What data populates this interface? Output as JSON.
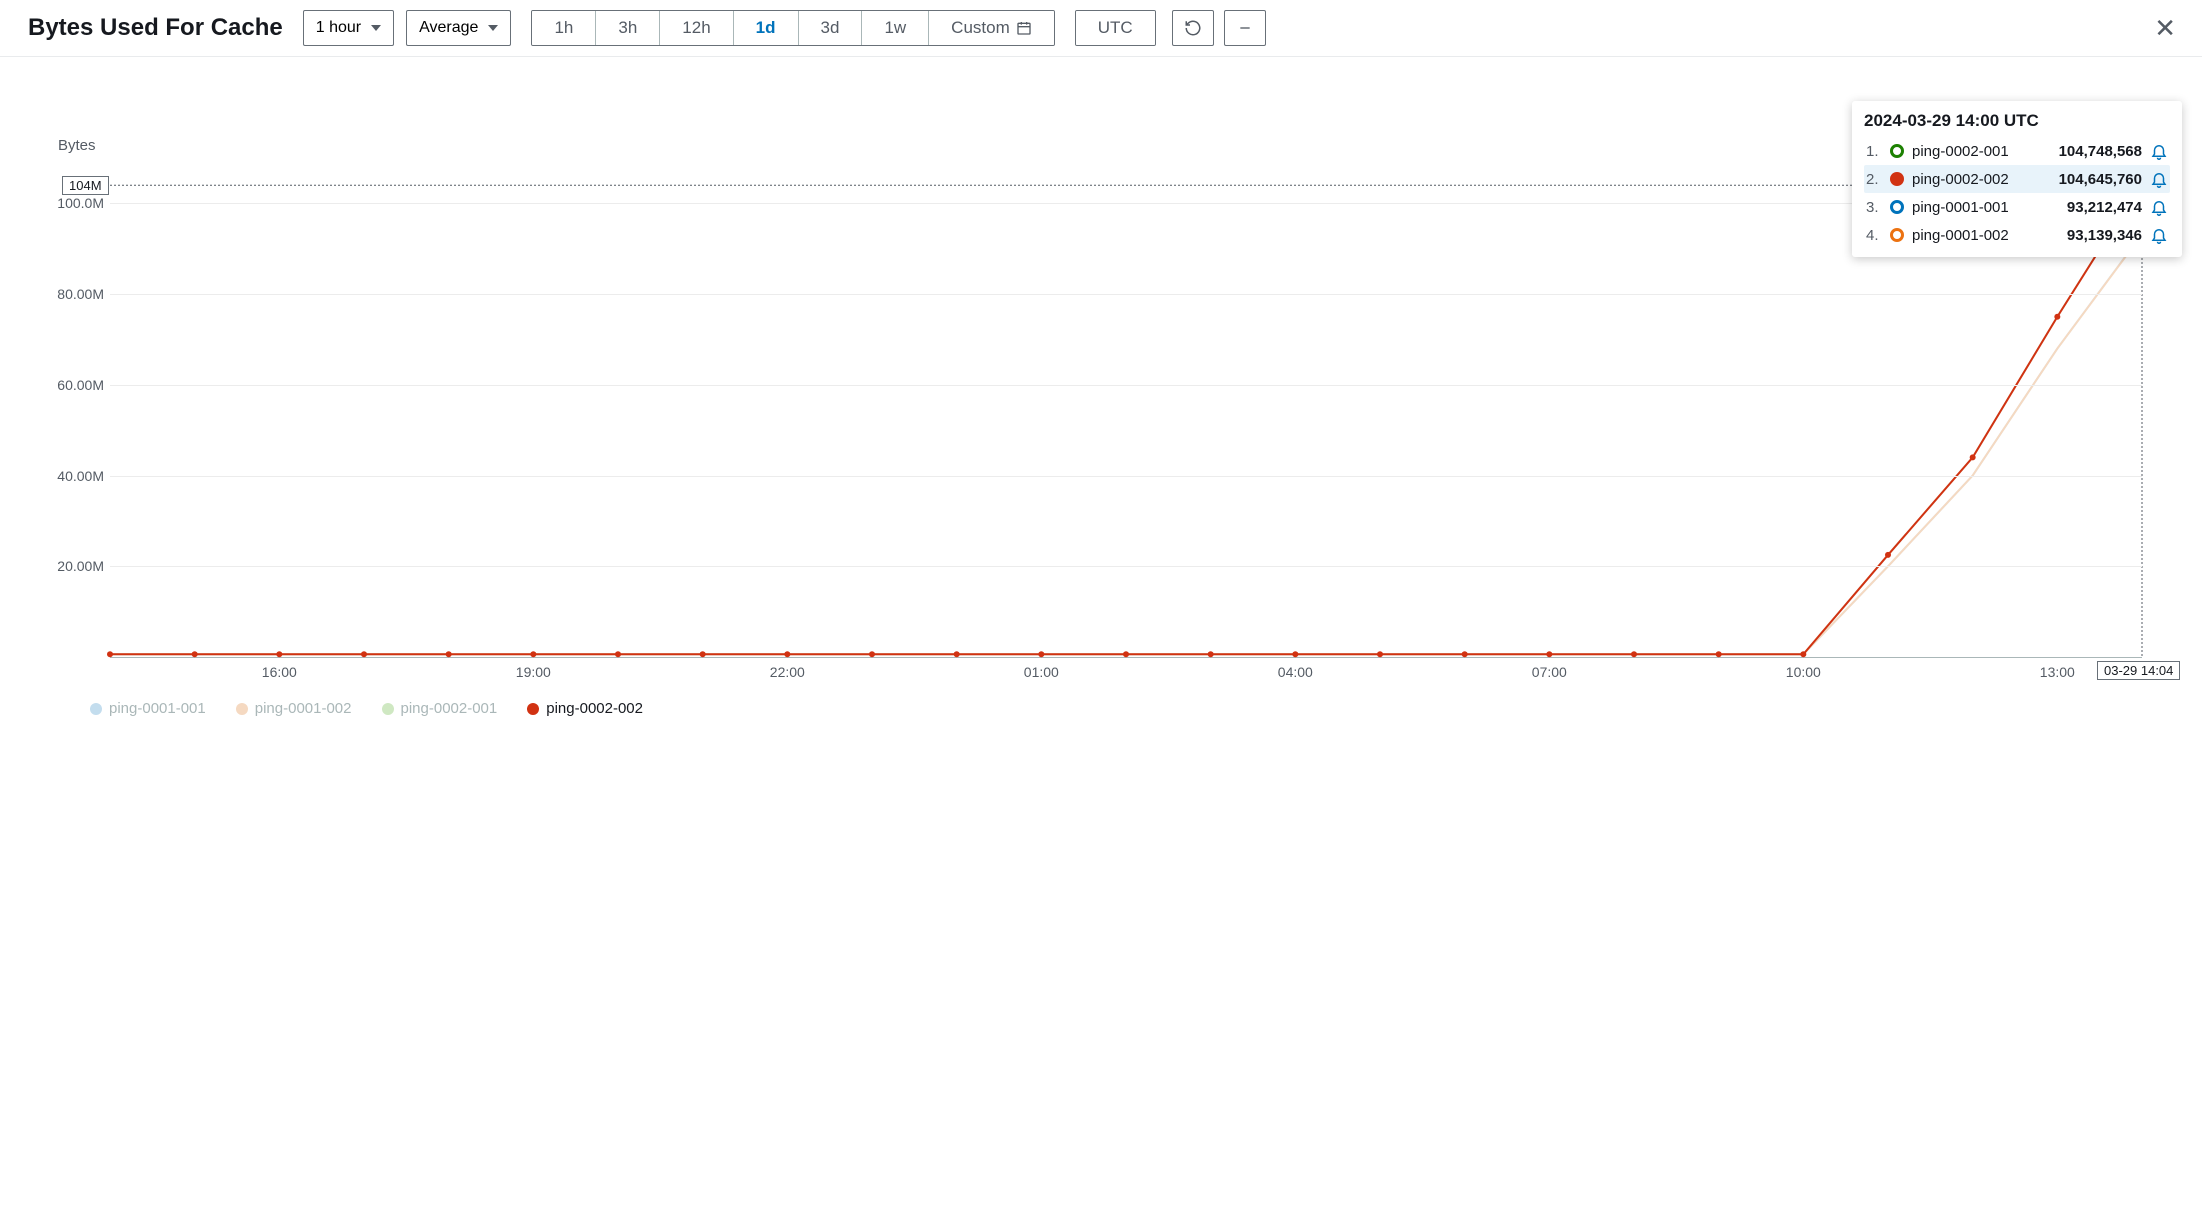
{
  "header": {
    "title": "Bytes Used For Cache",
    "period_select": "1 hour",
    "stat_select": "Average",
    "ranges": [
      "1h",
      "3h",
      "12h",
      "1d",
      "3d",
      "1w"
    ],
    "active_range_index": 3,
    "custom_label": "Custom",
    "timezone_label": "UTC"
  },
  "chart_data": {
    "type": "line",
    "ylabel": "Bytes",
    "ylim": [
      0,
      110000000
    ],
    "yticks": [
      {
        "v": 20000000,
        "label": "20.00M"
      },
      {
        "v": 40000000,
        "label": "40.00M"
      },
      {
        "v": 60000000,
        "label": "60.00M"
      },
      {
        "v": 80000000,
        "label": "80.00M"
      },
      {
        "v": 100000000,
        "label": "100.0M"
      }
    ],
    "x_hours": [
      14,
      15,
      16,
      17,
      18,
      19,
      20,
      21,
      22,
      23,
      24,
      25,
      26,
      27,
      28,
      29,
      30,
      31,
      32,
      33,
      34,
      35,
      36,
      37,
      38
    ],
    "xticks": [
      {
        "h": 16,
        "label": "16:00"
      },
      {
        "h": 19,
        "label": "19:00"
      },
      {
        "h": 22,
        "label": "22:00"
      },
      {
        "h": 25,
        "label": "01:00"
      },
      {
        "h": 28,
        "label": "04:00"
      },
      {
        "h": 31,
        "label": "07:00"
      },
      {
        "h": 34,
        "label": "10:00"
      },
      {
        "h": 37,
        "label": "13:00"
      }
    ],
    "series": [
      {
        "name": "ping-0001-001",
        "color": "#c3ddee",
        "legend_color": "#c3ddee",
        "values": [
          600000,
          600000,
          600000,
          600000,
          600000,
          600000,
          600000,
          600000,
          600000,
          600000,
          600000,
          600000,
          600000,
          600000,
          600000,
          600000,
          600000,
          600000,
          600000,
          600000,
          600000,
          20000000,
          40000000,
          68000000,
          93212474
        ]
      },
      {
        "name": "ping-0001-002",
        "color": "#f5d9c1",
        "legend_color": "#f5d9c1",
        "values": [
          600000,
          600000,
          600000,
          600000,
          600000,
          600000,
          600000,
          600000,
          600000,
          600000,
          600000,
          600000,
          600000,
          600000,
          600000,
          600000,
          600000,
          600000,
          600000,
          600000,
          600000,
          20000000,
          40000000,
          68000000,
          93139346
        ]
      },
      {
        "name": "ping-0002-001",
        "color": "#cfe8c2",
        "legend_color": "#cfe8c2",
        "values": [
          600000,
          600000,
          600000,
          600000,
          600000,
          600000,
          600000,
          600000,
          600000,
          600000,
          600000,
          600000,
          600000,
          600000,
          600000,
          600000,
          600000,
          600000,
          600000,
          600000,
          600000,
          22500000,
          44000000,
          75000000,
          104748568
        ]
      },
      {
        "name": "ping-0002-002",
        "color": "#d13212",
        "legend_color": "#d13212",
        "values": [
          600000,
          600000,
          600000,
          600000,
          600000,
          600000,
          600000,
          600000,
          600000,
          600000,
          600000,
          600000,
          600000,
          600000,
          600000,
          600000,
          600000,
          600000,
          600000,
          600000,
          600000,
          22500000,
          44000000,
          75000000,
          104645760
        ]
      }
    ],
    "hover": {
      "x_hour": 38,
      "y_badge_value": 104000000,
      "y_badge_label": "104M",
      "x_badge_label": "03-29 14:04"
    }
  },
  "tooltip": {
    "title": "2024-03-29 14:00 UTC",
    "highlight_index": 1,
    "rows": [
      {
        "idx": "1.",
        "ring": "#1d8102",
        "name": "ping-0002-001",
        "value": "104,748,568"
      },
      {
        "idx": "2.",
        "solid": "#d13212",
        "name": "ping-0002-002",
        "value": "104,645,760"
      },
      {
        "idx": "3.",
        "ring": "#0073bb",
        "name": "ping-0001-001",
        "value": "93,212,474"
      },
      {
        "idx": "4.",
        "ring": "#ec7211",
        "name": "ping-0001-002",
        "value": "93,139,346"
      }
    ]
  }
}
